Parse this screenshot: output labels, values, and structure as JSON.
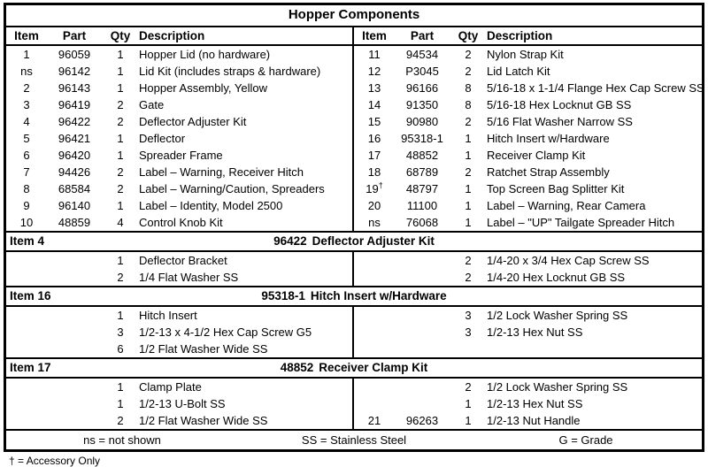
{
  "title": "Hopper Components",
  "columns": {
    "item": "Item",
    "part": "Part",
    "qty": "Qty",
    "desc": "Description"
  },
  "main_left": [
    {
      "item": "1",
      "part": "96059",
      "qty": "1",
      "desc": "Hopper Lid (no hardware)"
    },
    {
      "item": "ns",
      "part": "96142",
      "qty": "1",
      "desc": "Lid Kit (includes straps & hardware)"
    },
    {
      "item": "2",
      "part": "96143",
      "qty": "1",
      "desc": "Hopper Assembly, Yellow"
    },
    {
      "item": "3",
      "part": "96419",
      "qty": "2",
      "desc": "Gate"
    },
    {
      "item": "4",
      "part": "96422",
      "qty": "2",
      "desc": "Deflector Adjuster Kit"
    },
    {
      "item": "5",
      "part": "96421",
      "qty": "1",
      "desc": "Deflector"
    },
    {
      "item": "6",
      "part": "96420",
      "qty": "1",
      "desc": "Spreader Frame"
    },
    {
      "item": "7",
      "part": "94426",
      "qty": "2",
      "desc": "Label – Warning, Receiver Hitch"
    },
    {
      "item": "8",
      "part": "68584",
      "qty": "2",
      "desc": "Label – Warning/Caution, Spreaders"
    },
    {
      "item": "9",
      "part": "96140",
      "qty": "1",
      "desc": "Label – Identity, Model 2500"
    },
    {
      "item": "10",
      "part": "48859",
      "qty": "4",
      "desc": "Control Knob Kit"
    }
  ],
  "main_right": [
    {
      "item": "11",
      "part": "94534",
      "qty": "2",
      "desc": "Nylon Strap Kit"
    },
    {
      "item": "12",
      "part": "P3045",
      "qty": "2",
      "desc": "Lid Latch Kit"
    },
    {
      "item": "13",
      "part": "96166",
      "qty": "8",
      "desc": "5/16-18 x 1-1/4 Flange Hex Cap Screw SS"
    },
    {
      "item": "14",
      "part": "91350",
      "qty": "8",
      "desc": "5/16-18 Hex Locknut GB SS"
    },
    {
      "item": "15",
      "part": "90980",
      "qty": "2",
      "desc": "5/16 Flat Washer Narrow SS"
    },
    {
      "item": "16",
      "part": "95318-1",
      "qty": "1",
      "desc": "Hitch Insert w/Hardware"
    },
    {
      "item": "17",
      "part": "48852",
      "qty": "1",
      "desc": "Receiver Clamp Kit"
    },
    {
      "item": "18",
      "part": "68789",
      "qty": "2",
      "desc": "Ratchet Strap Assembly"
    },
    {
      "item": "19",
      "item_dagger": true,
      "part": "48797",
      "qty": "1",
      "desc": "Top Screen Bag Splitter Kit"
    },
    {
      "item": "20",
      "part": "11100",
      "qty": "1",
      "desc": "Label – Warning, Rear Camera"
    },
    {
      "item": "ns",
      "part": "76068",
      "qty": "1",
      "desc": "Label – \"UP\" Tailgate Spreader Hitch"
    }
  ],
  "sections": [
    {
      "label": "Item 4",
      "part_number": "96422",
      "name": "Deflector Adjuster Kit",
      "left": [
        {
          "item": "",
          "part": "",
          "qty": "1",
          "desc": "Deflector Bracket"
        },
        {
          "item": "",
          "part": "",
          "qty": "2",
          "desc": "1/4 Flat Washer SS"
        }
      ],
      "right": [
        {
          "item": "",
          "part": "",
          "qty": "2",
          "desc": "1/4-20 x 3/4 Hex Cap Screw SS"
        },
        {
          "item": "",
          "part": "",
          "qty": "2",
          "desc": "1/4-20 Hex Locknut GB SS"
        }
      ]
    },
    {
      "label": "Item 16",
      "part_number": "95318-1",
      "name": "Hitch Insert w/Hardware",
      "left": [
        {
          "item": "",
          "part": "",
          "qty": "1",
          "desc": "Hitch Insert"
        },
        {
          "item": "",
          "part": "",
          "qty": "3",
          "desc": "1/2-13 x 4-1/2 Hex Cap Screw G5"
        },
        {
          "item": "",
          "part": "",
          "qty": "6",
          "desc": "1/2 Flat Washer Wide SS"
        }
      ],
      "right": [
        {
          "item": "",
          "part": "",
          "qty": "3",
          "desc": "1/2 Lock Washer Spring SS"
        },
        {
          "item": "",
          "part": "",
          "qty": "3",
          "desc": "1/2-13 Hex Nut SS"
        },
        {
          "item": "",
          "part": "",
          "qty": "",
          "desc": ""
        }
      ]
    },
    {
      "label": "Item 17",
      "part_number": "48852",
      "name": "Receiver Clamp Kit",
      "left": [
        {
          "item": "",
          "part": "",
          "qty": "1",
          "desc": "Clamp Plate"
        },
        {
          "item": "",
          "part": "",
          "qty": "1",
          "desc": "1/2-13 U-Bolt SS"
        },
        {
          "item": "",
          "part": "",
          "qty": "2",
          "desc": "1/2 Flat Washer Wide SS"
        }
      ],
      "right": [
        {
          "item": "",
          "part": "",
          "qty": "2",
          "desc": "1/2 Lock Washer Spring SS"
        },
        {
          "item": "",
          "part": "",
          "qty": "1",
          "desc": "1/2-13 Hex Nut SS"
        },
        {
          "item": "21",
          "part": "96263",
          "qty": "1",
          "desc": "1/2-13 Nut Handle"
        }
      ]
    }
  ],
  "legend": [
    "ns = not shown",
    "SS = Stainless Steel",
    "G = Grade"
  ],
  "footnote": "† = Accessory Only"
}
